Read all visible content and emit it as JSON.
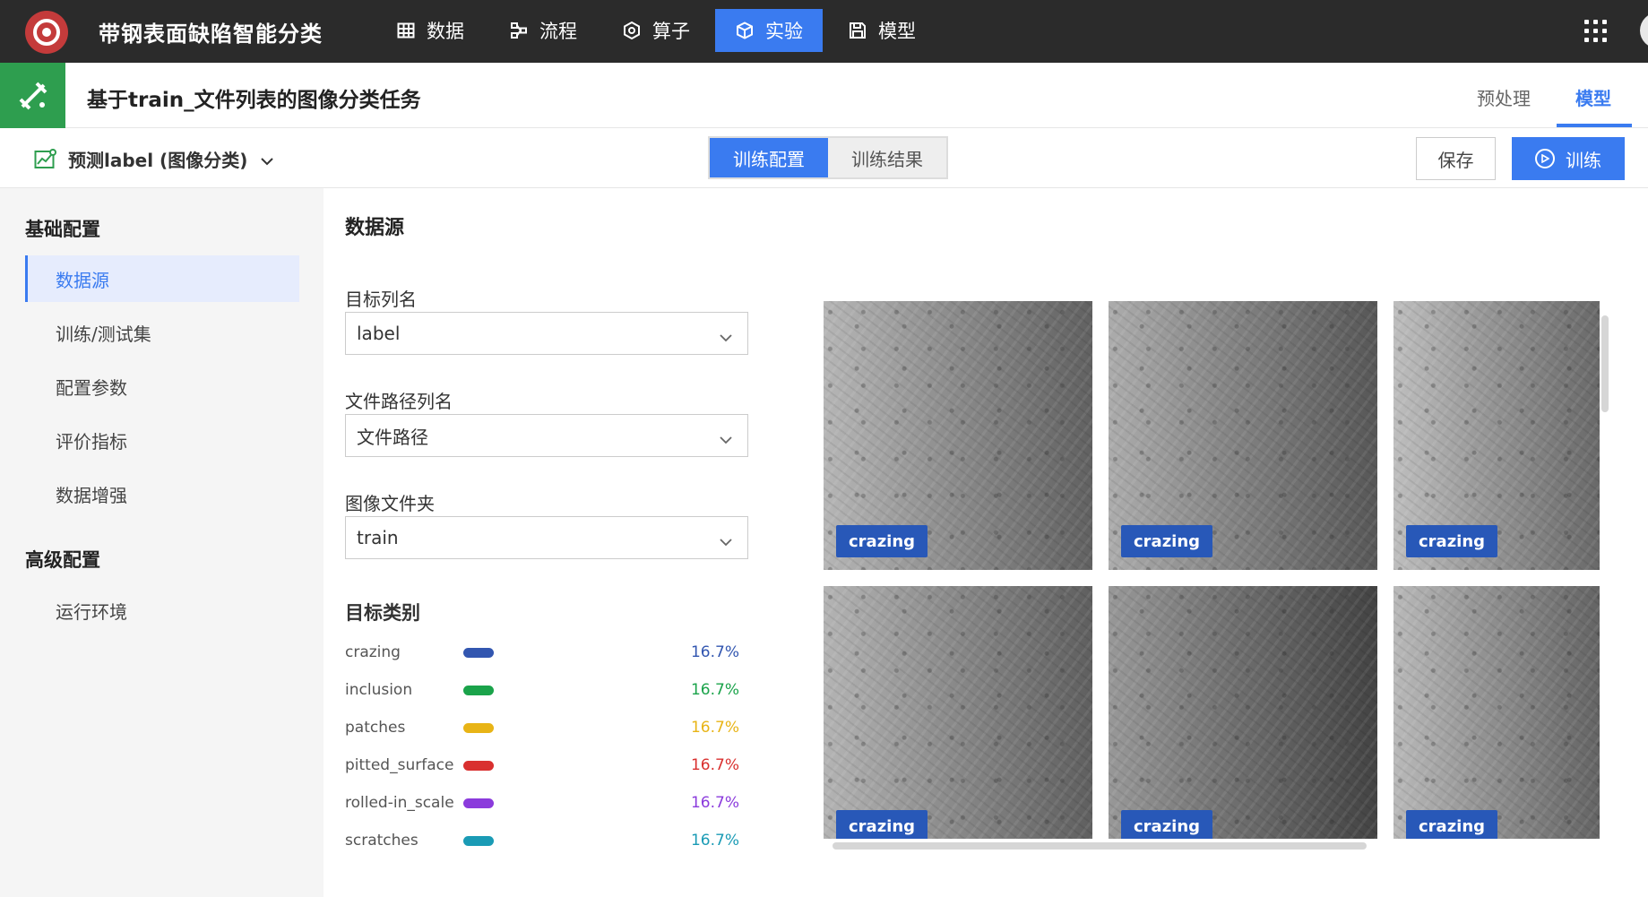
{
  "app": {
    "title": "带钢表面缺陷智能分类",
    "nav": [
      {
        "label": "数据",
        "icon": "table-icon"
      },
      {
        "label": "流程",
        "icon": "flow-icon"
      },
      {
        "label": "算子",
        "icon": "operator-icon"
      },
      {
        "label": "实验",
        "icon": "cube-icon",
        "active": true
      },
      {
        "label": "模型",
        "icon": "save-icon"
      }
    ]
  },
  "task": {
    "title": "基于train_文件列表的图像分类任务",
    "tabs": [
      {
        "label": "预处理"
      },
      {
        "label": "模型",
        "active": true
      }
    ]
  },
  "toolbar": {
    "predict_label": "预测label (图像分类)",
    "segments": [
      {
        "label": "训练配置",
        "active": true
      },
      {
        "label": "训练结果"
      }
    ],
    "save_label": "保存",
    "train_label": "训练"
  },
  "sidebar": {
    "sections": [
      {
        "title": "基础配置",
        "items": [
          {
            "label": "数据源",
            "active": true
          },
          {
            "label": "训练/测试集"
          },
          {
            "label": "配置参数"
          },
          {
            "label": "评价指标"
          },
          {
            "label": "数据增强"
          }
        ]
      },
      {
        "title": "高级配置",
        "items": [
          {
            "label": "运行环境"
          }
        ]
      }
    ]
  },
  "main": {
    "title": "数据源",
    "fields": [
      {
        "label": "目标列名",
        "value": "label"
      },
      {
        "label": "文件路径列名",
        "value": "文件路径"
      },
      {
        "label": "图像文件夹",
        "value": "train"
      }
    ],
    "categories_title": "目标类别",
    "categories": [
      {
        "name": "crazing",
        "pct": "16.7%",
        "color": "#3256b0"
      },
      {
        "name": "inclusion",
        "pct": "16.7%",
        "color": "#1aa34a"
      },
      {
        "name": "patches",
        "pct": "16.7%",
        "color": "#e8b416"
      },
      {
        "name": "pitted_surface",
        "pct": "16.7%",
        "color": "#d9302f"
      },
      {
        "name": "rolled-in_scale",
        "pct": "16.7%",
        "color": "#8b3bdc"
      },
      {
        "name": "scratches",
        "pct": "16.7%",
        "color": "#1a9bb5"
      }
    ],
    "gallery": [
      {
        "tag": "crazing"
      },
      {
        "tag": "crazing"
      },
      {
        "tag": "crazing"
      },
      {
        "tag": "crazing"
      },
      {
        "tag": "crazing"
      },
      {
        "tag": "crazing"
      }
    ]
  }
}
